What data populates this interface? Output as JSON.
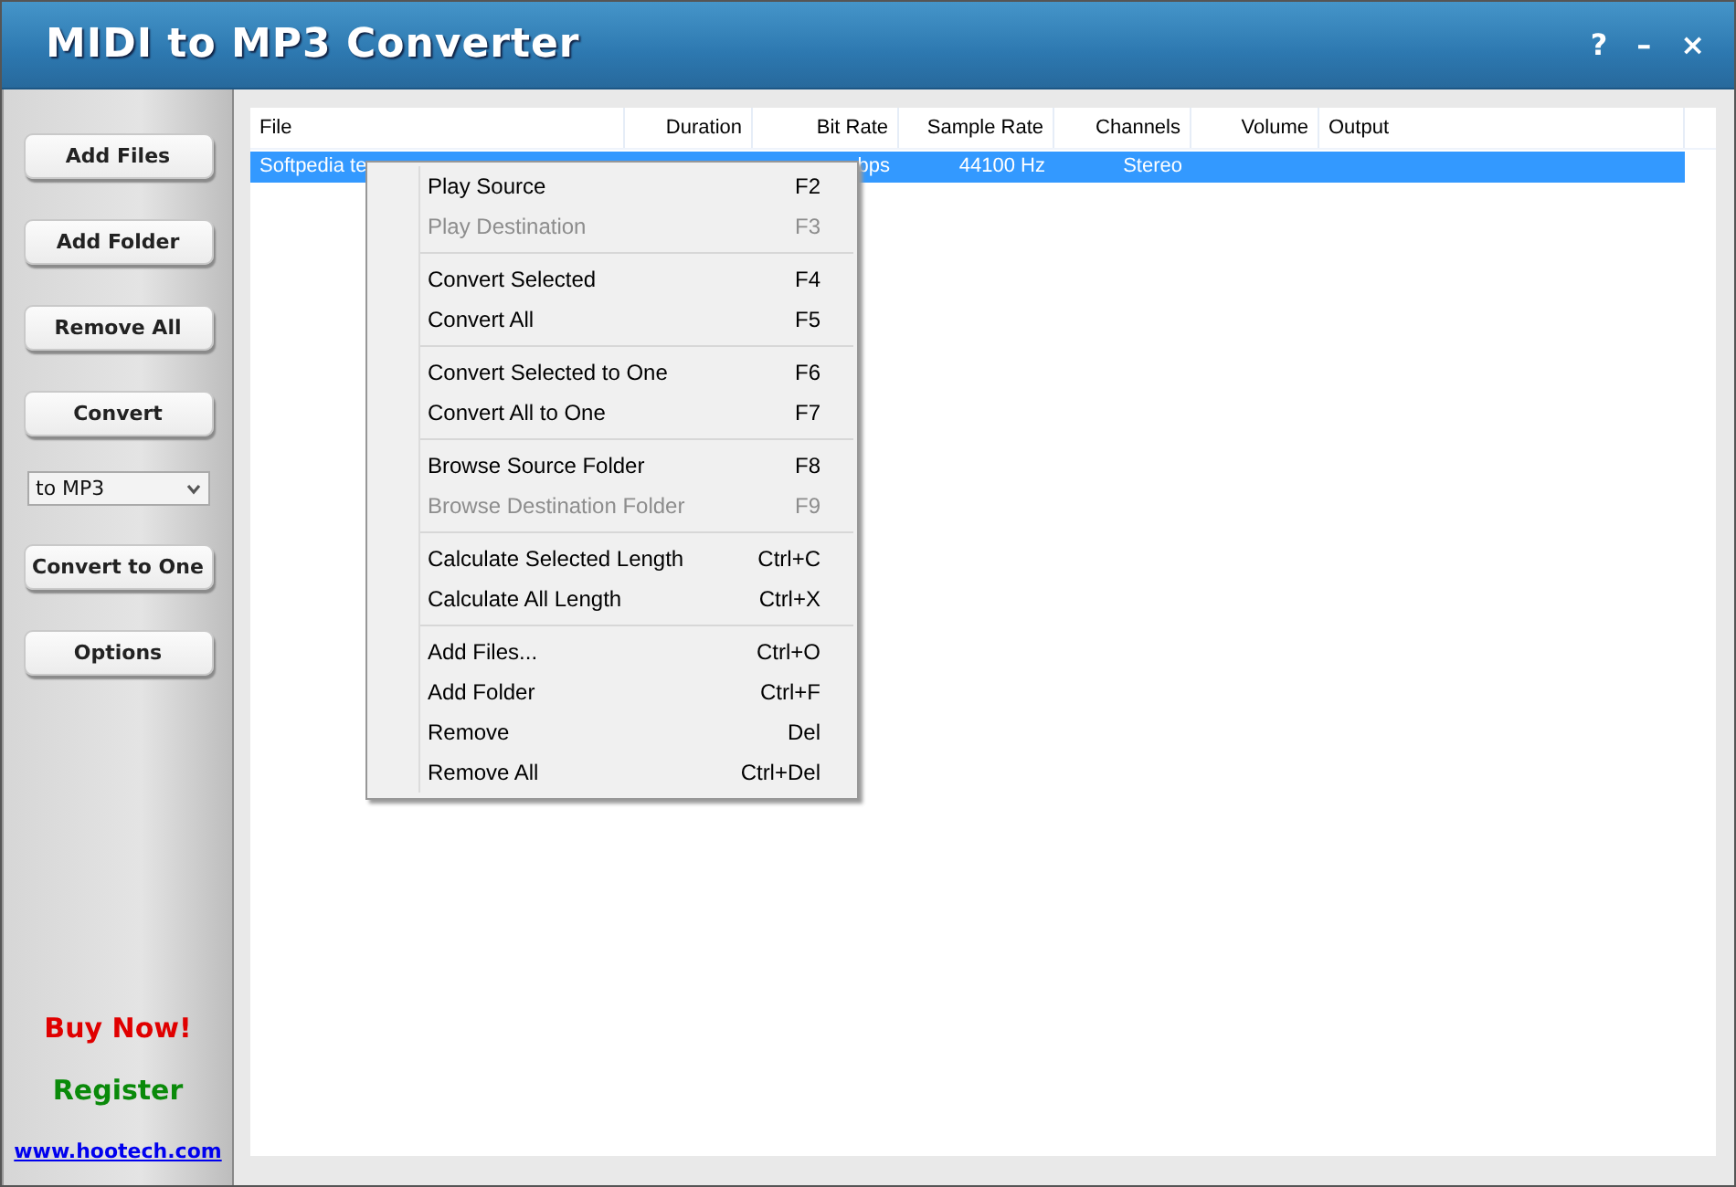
{
  "window": {
    "title": "MIDI to MP3 Converter",
    "controls": [
      "?",
      "–",
      "×"
    ]
  },
  "sidebar": {
    "buttons": [
      {
        "kind": "button",
        "label": "Add Files"
      },
      {
        "kind": "button",
        "label": "Add Folder"
      },
      {
        "kind": "button",
        "label": "Remove All"
      },
      {
        "kind": "button",
        "label": "Convert"
      },
      {
        "kind": "dropdown",
        "label": "to MP3"
      },
      {
        "kind": "button",
        "label": "Convert to One"
      },
      {
        "kind": "button",
        "label": "Options"
      }
    ],
    "buy_now": "Buy Now!",
    "register": "Register",
    "website": "www.hootech.com"
  },
  "table": {
    "columns": [
      "File",
      "Duration",
      "Bit Rate",
      "Sample Rate",
      "Channels",
      "Volume",
      "Output"
    ],
    "rows": [
      {
        "selected": true,
        "cells": [
          "Softpedia te",
          "",
          "bps",
          "44100 Hz",
          "Stereo",
          "",
          ""
        ]
      }
    ]
  },
  "context_menu": [
    {
      "kind": "item",
      "label": "Play Source",
      "shortcut": "F2",
      "disabled": false
    },
    {
      "kind": "item",
      "label": "Play Destination",
      "shortcut": "F3",
      "disabled": true
    },
    {
      "kind": "separator"
    },
    {
      "kind": "item",
      "label": "Convert Selected",
      "shortcut": "F4",
      "disabled": false
    },
    {
      "kind": "item",
      "label": "Convert All",
      "shortcut": "F5",
      "disabled": false
    },
    {
      "kind": "separator"
    },
    {
      "kind": "item",
      "label": "Convert Selected to One",
      "shortcut": "F6",
      "disabled": false
    },
    {
      "kind": "item",
      "label": "Convert All to One",
      "shortcut": "F7",
      "disabled": false
    },
    {
      "kind": "separator"
    },
    {
      "kind": "item",
      "label": "Browse Source Folder",
      "shortcut": "F8",
      "disabled": false
    },
    {
      "kind": "item",
      "label": "Browse Destination Folder",
      "shortcut": "F9",
      "disabled": true
    },
    {
      "kind": "separator"
    },
    {
      "kind": "item",
      "label": "Calculate Selected Length",
      "shortcut": "Ctrl+C",
      "disabled": false
    },
    {
      "kind": "item",
      "label": "Calculate All Length",
      "shortcut": "Ctrl+X",
      "disabled": false
    },
    {
      "kind": "separator"
    },
    {
      "kind": "item",
      "label": "Add Files...",
      "shortcut": "Ctrl+O",
      "disabled": false
    },
    {
      "kind": "item",
      "label": "Add Folder",
      "shortcut": "Ctrl+F",
      "disabled": false
    },
    {
      "kind": "item",
      "label": "Remove",
      "shortcut": "Del",
      "disabled": false
    },
    {
      "kind": "item",
      "label": "Remove All",
      "shortcut": "Ctrl+Del",
      "disabled": false
    }
  ]
}
